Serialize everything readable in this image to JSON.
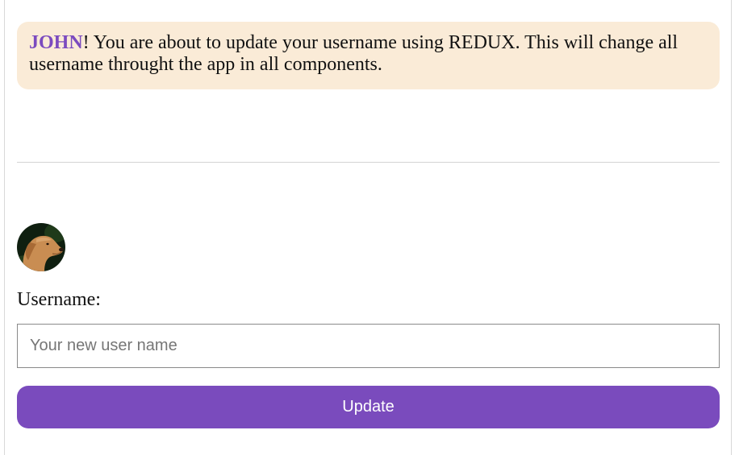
{
  "alert": {
    "username": "JOHN",
    "message": "! You are about to update your username using REDUX. This will change all username throught the app in all components."
  },
  "profile": {
    "avatar_icon": "dog-avatar-photo"
  },
  "form": {
    "label": "Username:",
    "placeholder": "Your new user name",
    "value": "",
    "button_label": "Update"
  },
  "colors": {
    "accent": "#7a4bbd",
    "alert_bg": "#faebd7",
    "name_color": "#7b4bbf"
  }
}
